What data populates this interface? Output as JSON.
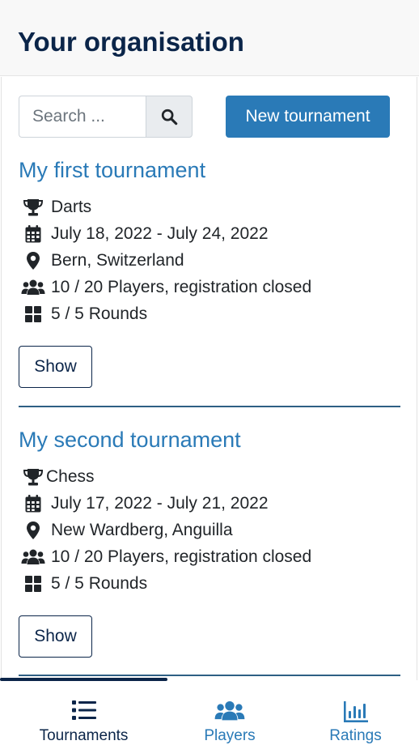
{
  "header": {
    "title": "Your organisation"
  },
  "search": {
    "placeholder": "Search ..."
  },
  "toolbar": {
    "new_tournament_label": "New tournament"
  },
  "tournaments": [
    {
      "title": "My first tournament",
      "game": "Darts",
      "dates": "July 18, 2022 - July 24, 2022",
      "location": "Bern, Switzerland",
      "players": "10 / 20 Players, registration closed",
      "rounds": "5 / 5 Rounds",
      "show_label": "Show"
    },
    {
      "title": "My second tournament",
      "game": "Chess",
      "dates": "July 17, 2022 - July 21, 2022",
      "location": "New Wardberg, Anguilla",
      "players": "10 / 20 Players, registration closed",
      "rounds": "5 / 5 Rounds",
      "show_label": "Show"
    }
  ],
  "nav": {
    "items": [
      {
        "label": "Tournaments",
        "icon": "list-icon",
        "active": true
      },
      {
        "label": "Players",
        "icon": "users-icon",
        "active": false
      },
      {
        "label": "Ratings",
        "icon": "chart-bar-icon",
        "active": false
      }
    ]
  },
  "colors": {
    "brand_dark": "#0b2549",
    "accent": "#2a7ab7",
    "header_bg": "#f8f8f8"
  }
}
